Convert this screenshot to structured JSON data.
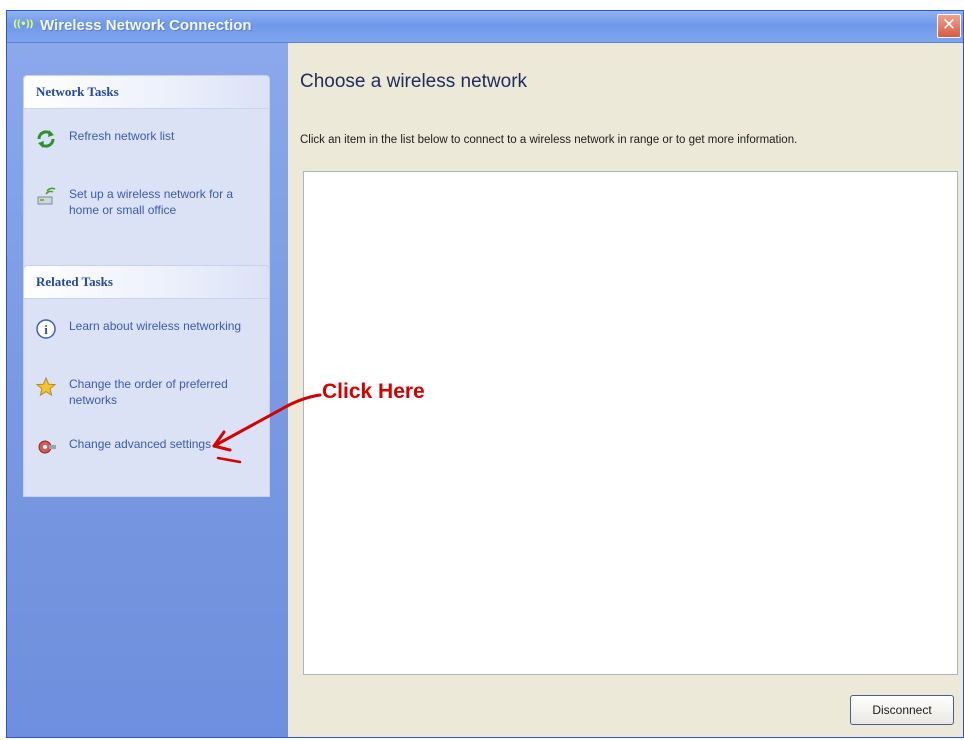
{
  "window": {
    "title": "Wireless Network Connection",
    "title_icon": "((•))",
    "close_glyph": "✕"
  },
  "sidebar": {
    "network_tasks": {
      "header": "Network Tasks",
      "items": [
        {
          "label": "Refresh network list",
          "icon": "refresh-icon"
        },
        {
          "label": "Set up a wireless network for a home or small office",
          "icon": "setup-network-icon"
        }
      ]
    },
    "related_tasks": {
      "header": "Related Tasks",
      "items": [
        {
          "label": "Learn about wireless networking",
          "icon": "info-icon"
        },
        {
          "label": "Change the order of preferred networks",
          "icon": "star-icon"
        },
        {
          "label": "Change advanced settings",
          "icon": "settings-icon"
        }
      ]
    }
  },
  "main": {
    "heading": "Choose a wireless network",
    "description": "Click an item in the list below to connect to a wireless network in range or to get more information.",
    "disconnect_label": "Disconnect"
  },
  "annotation": {
    "label": "Click Here",
    "color": "#d40000"
  },
  "colors": {
    "sidebar": "#7b99e2",
    "panel": "#dbe2f6",
    "panel_header_text": "#2448a8",
    "task_text": "#3a5bb0",
    "window_bg": "#ece9d8"
  }
}
